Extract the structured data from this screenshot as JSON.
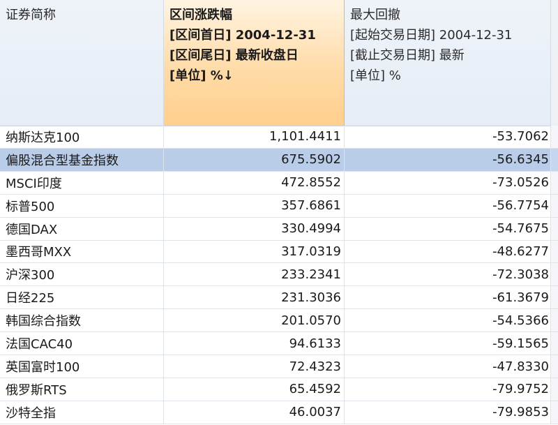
{
  "header": {
    "name": [
      "证券简称"
    ],
    "change": [
      "区间涨跌幅",
      "[区间首日] 2004-12-31",
      "[区间尾日] 最新收盘日",
      "[单位] %↓"
    ],
    "drawdown": [
      "最大回撤",
      "[起始交易日期] 2004-12-31",
      "[截止交易日期] 最新",
      "[单位] %"
    ]
  },
  "rows": [
    {
      "name": "纳斯达克100",
      "change": "1,101.4411",
      "drawdown": "-53.7062"
    },
    {
      "name": "偏股混合型基金指数",
      "change": "675.5902",
      "drawdown": "-56.6345",
      "selected": true
    },
    {
      "name": "MSCI印度",
      "change": "472.8552",
      "drawdown": "-73.0526"
    },
    {
      "name": "标普500",
      "change": "357.6861",
      "drawdown": "-56.7754"
    },
    {
      "name": "德国DAX",
      "change": "330.4994",
      "drawdown": "-54.7675"
    },
    {
      "name": "墨西哥MXX",
      "change": "317.0319",
      "drawdown": "-48.6277"
    },
    {
      "name": "沪深300",
      "change": "233.2341",
      "drawdown": "-72.3038"
    },
    {
      "name": "日经225",
      "change": "231.3036",
      "drawdown": "-61.3679"
    },
    {
      "name": "韩国综合指数",
      "change": "201.0570",
      "drawdown": "-54.5366"
    },
    {
      "name": "法国CAC40",
      "change": "94.6133",
      "drawdown": "-59.1565"
    },
    {
      "name": "英国富时100",
      "change": "72.4323",
      "drawdown": "-47.8330"
    },
    {
      "name": "俄罗斯RTS",
      "change": "65.4592",
      "drawdown": "-79.9752"
    },
    {
      "name": "沙特全指",
      "change": "46.0037",
      "drawdown": "-79.9853"
    }
  ]
}
